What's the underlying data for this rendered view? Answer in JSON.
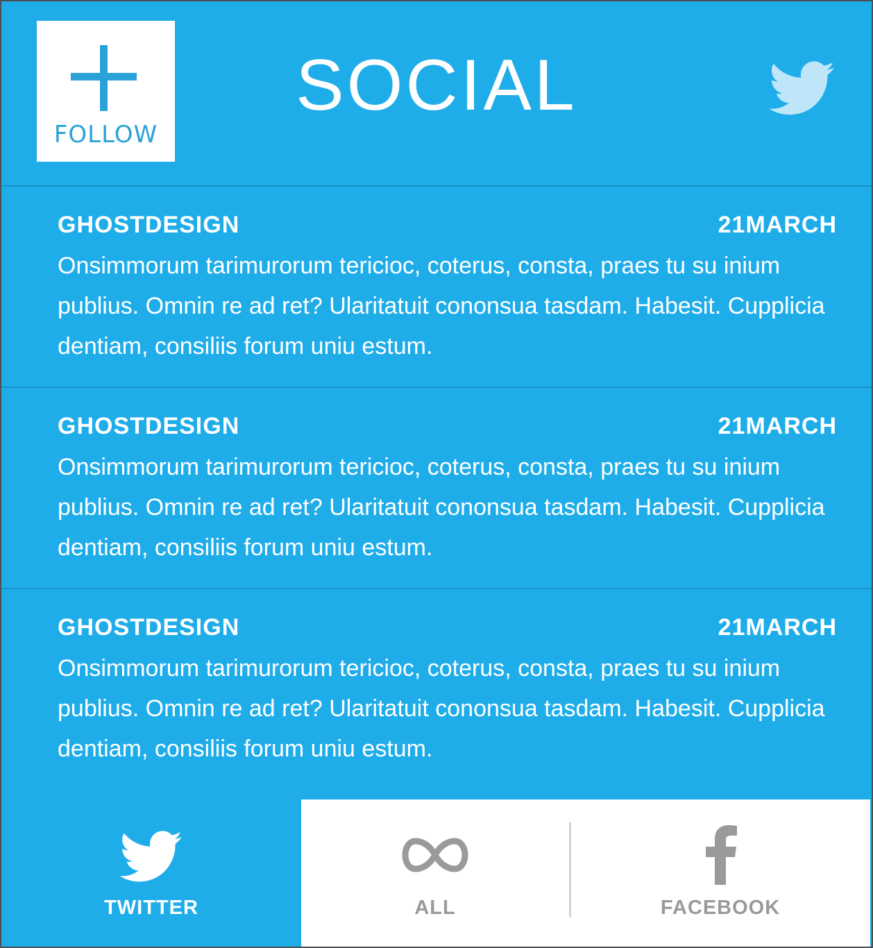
{
  "header": {
    "title": "SOCIAL",
    "follow_label": "FOLLOW"
  },
  "posts": [
    {
      "author": "GHOSTDESIGN",
      "date": "21MARCH",
      "text": "Onsimmorum tarimurorum tericioc, coterus, consta, praes tu su inium publius. Omnin re ad ret? Ularitatuit cononsua tasdam. Habesit. Cupplicia dentiam, consiliis forum uniu estum."
    },
    {
      "author": "GHOSTDESIGN",
      "date": "21MARCH",
      "text": "Onsimmorum tarimurorum tericioc, coterus, consta, praes tu su inium publius. Omnin re ad ret? Ularitatuit cononsua tasdam. Habesit. Cupplicia dentiam, consiliis forum uniu estum."
    },
    {
      "author": "GHOSTDESIGN",
      "date": "21MARCH",
      "text": "Onsimmorum tarimurorum tericioc, coterus, consta, praes tu su inium publius. Omnin re ad ret? Ularitatuit cononsua tasdam. Habesit. Cupplicia dentiam, consiliis forum uniu estum."
    }
  ],
  "tabs": {
    "twitter_label": "TWITTER",
    "all_label": "ALL",
    "facebook_label": "FACEBOOK",
    "active": "twitter"
  },
  "icons": {
    "follow": "plus-icon",
    "header": "twitter-bird-icon",
    "twitter_tab": "twitter-bird-icon",
    "all_tab": "infinity-icon",
    "facebook_tab": "facebook-icon"
  },
  "colors": {
    "background": "#1fadea",
    "accent": "#2aa2d8",
    "panel": "#ffffff",
    "inactive_text": "#9a9a9a"
  }
}
